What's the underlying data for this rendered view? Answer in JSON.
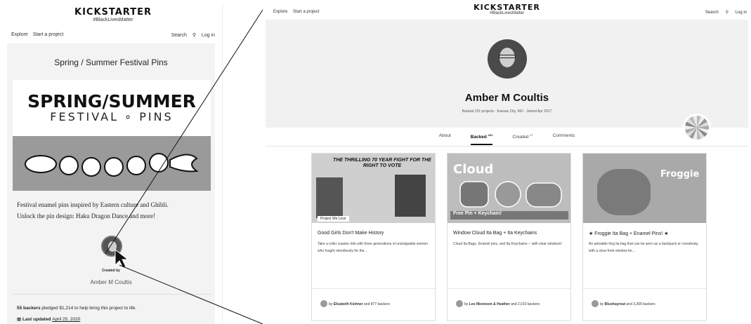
{
  "brand": {
    "logo": "KICKSTARTER",
    "tagline": "#BlackLivesMatter"
  },
  "nav": {
    "explore": "Explore",
    "start": "Start a project",
    "search": "Search",
    "search_icon": "search-icon",
    "login": "Log in"
  },
  "project": {
    "title": "Spring / Summer Festival Pins",
    "banner_line1": "SPRING/SUMMER",
    "banner_line2": "FESTIVAL ∘ PINS",
    "desc_line1": "Festival enamel pins inspired by Eastern culture and Ghibli.",
    "desc_line2": "Unlock the pin design: Haku Dragon Dance and more!",
    "created_by": "Created by",
    "creator": "Amber M Coultis",
    "backers_count": "55 backers",
    "backers_text": " pledged $1,214 to help bring this project to life.",
    "updated_label": "Last updated ",
    "updated_date": "April 25, 2020"
  },
  "profile": {
    "name": "Amber M Coultis",
    "meta": "Backed 231 projects · Kansas City, MO · Joined Apr 2017",
    "tabs": [
      {
        "label": "About",
        "count": ""
      },
      {
        "label": "Backed",
        "count": "231"
      },
      {
        "label": "Created",
        "count": "17"
      },
      {
        "label": "Comments",
        "count": ""
      }
    ]
  },
  "cards": [
    {
      "image_text": "THE THRILLING 70 YEAR FIGHT FOR THE RIGHT TO VOTE",
      "badge": "Project We Love",
      "title": "Good Girls Don't Make History",
      "desc": "Take a roller coaster ride with three generations of unstoppable women who fought relentlessly for the...",
      "by_prefix": "by ",
      "creator": "Elizabeth Kiehner",
      "by_suffix": " and 877 backers"
    },
    {
      "image_text": "Cloud",
      "image_band": "Free Pin + Keychain!",
      "title": "Window Cloud Ita Bag + Ita Keychains",
      "desc": "Cloud Ita Bags, Enamel pins, and Ita Keychains -- with clear windows!",
      "by_prefix": "by ",
      "creator": "Leo Meowson & Heather",
      "by_suffix": " and 2,010 backers"
    },
    {
      "image_text": "Froggie",
      "title": "★ Froggie Ita Bag + Enamel Pins! ★",
      "desc": "An adorable frog ita bag that can be worn as a backpack or crossbody, with a clear front window for...",
      "by_prefix": "by ",
      "creator": "Blushsprout",
      "by_suffix": " and 3,365 backers"
    }
  ]
}
